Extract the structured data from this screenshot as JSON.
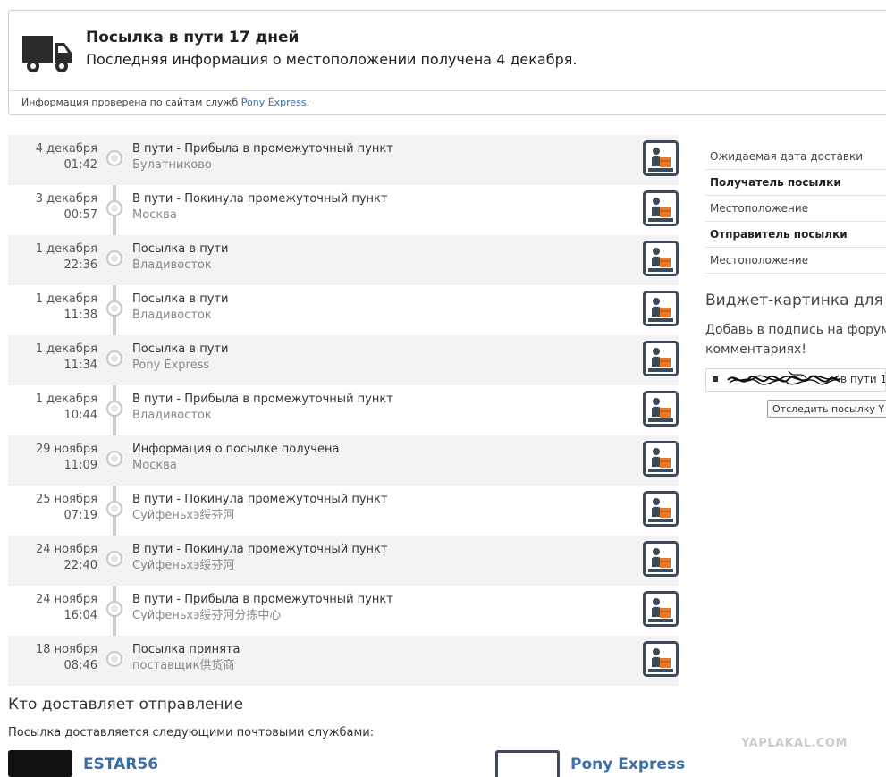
{
  "status": {
    "title": "Посылка в пути 17 дней",
    "subtitle": "Последняя информация о местоположении получена 4 декабря.",
    "verified_prefix": "Информация проверена по сайтам служб ",
    "verified_link": "Pony Express",
    "verified_suffix": "."
  },
  "events": [
    {
      "date": "4 декабря",
      "time": "01:42",
      "title": "В пути - Прибыла в промежуточный пункт",
      "place": "Булатниково"
    },
    {
      "date": "3 декабря",
      "time": "00:57",
      "title": "В пути - Покинула промежуточный пункт",
      "place": "Москва"
    },
    {
      "date": "1 декабря",
      "time": "22:36",
      "title": "Посылка в пути",
      "place": "Владивосток"
    },
    {
      "date": "1 декабря",
      "time": "11:38",
      "title": "Посылка в пути",
      "place": "Владивосток"
    },
    {
      "date": "1 декабря",
      "time": "11:34",
      "title": "Посылка в пути",
      "place": "Pony Express"
    },
    {
      "date": "1 декабря",
      "time": "10:44",
      "title": "В пути - Прибыла в промежуточный пункт",
      "place": "Владивосток"
    },
    {
      "date": "29 ноября",
      "time": "11:09",
      "title": "Информация о посылке получена",
      "place": "Москва"
    },
    {
      "date": "25 ноября",
      "time": "07:19",
      "title": "В пути - Покинула промежуточный пункт",
      "place": "Суйфеньхэ绥芬河"
    },
    {
      "date": "24 ноября",
      "time": "22:40",
      "title": "В пути - Покинула промежуточный пункт",
      "place": "Суйфеньхэ绥芬河"
    },
    {
      "date": "24 ноября",
      "time": "16:04",
      "title": "В пути - Прибыла в промежуточный пункт",
      "place": "Суйфеньхэ绥芬河分拣中心"
    },
    {
      "date": "18 ноября",
      "time": "08:46",
      "title": "Посылка принята",
      "place": "поставщик供货商"
    }
  ],
  "side": {
    "rows": [
      {
        "label": "Ожидаемая дата доставки",
        "bold": false
      },
      {
        "label": "Получатель посылки",
        "bold": true
      },
      {
        "label": "Местоположение",
        "bold": false
      },
      {
        "label": "Отправитель посылки",
        "bold": true
      },
      {
        "label": "Местоположение",
        "bold": false
      }
    ],
    "widget_title": "Виджет-картинка для ф",
    "widget_desc_1": "Добавь в подпись на форумах",
    "widget_desc_2": "комментариях!",
    "widget_text": "в пути 1",
    "tooltip": "Отследить посылку Y"
  },
  "carriers": {
    "title": "Кто доставляет отправление",
    "desc": "Посылка доставляется следующими почтовыми службами:",
    "first": "ESTAR56",
    "second": "Pony Express"
  },
  "watermark": "YAPLAKAL.COM",
  "colors": {
    "link": "#3b6ea5",
    "row_alt": "#f3f3f3",
    "icon_frame": "#3d4a5c",
    "icon_box": "#e8792b"
  }
}
